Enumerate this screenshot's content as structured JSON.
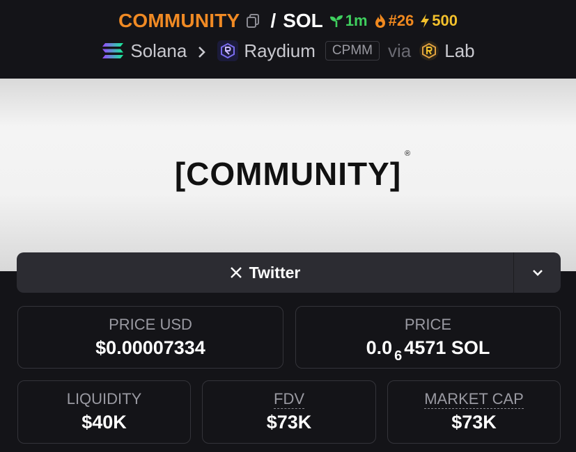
{
  "header": {
    "token_name": "COMMUNITY",
    "separator": "/",
    "quote_token": "SOL",
    "age": "1m",
    "rank": "#26",
    "boost": "500",
    "chain": "Solana",
    "dex": "Raydium",
    "pool_type": "CPMM",
    "via": "via",
    "launcher": "Lab"
  },
  "banner": {
    "text": "[COMMUNITY]",
    "registered_mark": "®"
  },
  "social": {
    "twitter_label": "Twitter"
  },
  "stats": {
    "price_usd_label": "PRICE USD",
    "price_usd_value": "$0.00007334",
    "price_label": "PRICE",
    "price_prefix": "0.0",
    "price_zeros": "6",
    "price_suffix": "4571 SOL",
    "liquidity_label": "LIQUIDITY",
    "liquidity_value": "$40K",
    "fdv_label": "FDV",
    "fdv_value": "$73K",
    "mcap_label": "MARKET CAP",
    "mcap_value": "$73K"
  },
  "colors": {
    "token": "#f08a24",
    "age": "#3fcf5e",
    "rank": "#f0891f",
    "boost": "#f3c12c",
    "background": "#141418"
  }
}
